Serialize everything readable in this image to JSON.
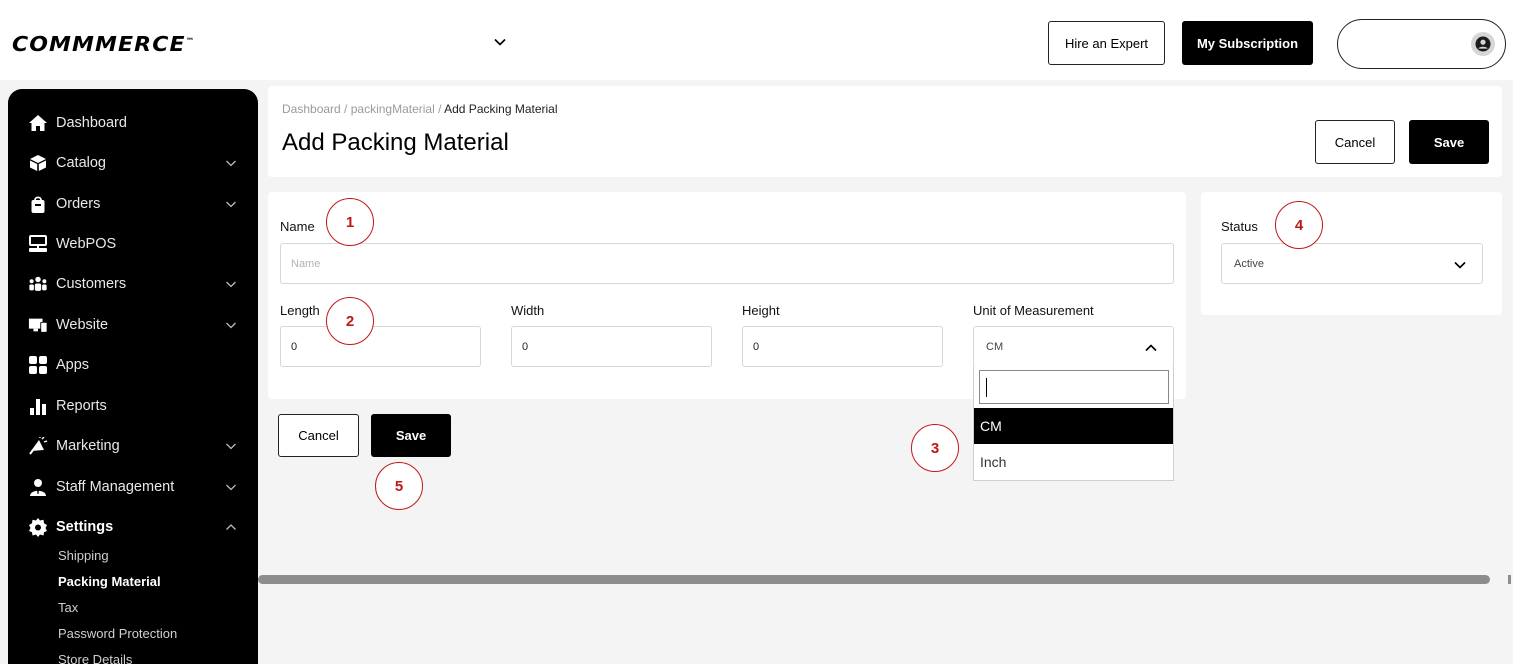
{
  "topbar": {
    "logo": "COMMMERCE",
    "logo_mark": "™",
    "hire_label": "Hire an Expert",
    "subscription_label": "My Subscription"
  },
  "sidebar": {
    "items": [
      {
        "label": "Dashboard",
        "icon": "home-icon",
        "has_chevron": false
      },
      {
        "label": "Catalog",
        "icon": "box-icon",
        "has_chevron": true
      },
      {
        "label": "Orders",
        "icon": "bag-icon",
        "has_chevron": true
      },
      {
        "label": "WebPOS",
        "icon": "pos-icon",
        "has_chevron": false
      },
      {
        "label": "Customers",
        "icon": "users-icon",
        "has_chevron": true
      },
      {
        "label": "Website",
        "icon": "website-icon",
        "has_chevron": true
      },
      {
        "label": "Apps",
        "icon": "apps-icon",
        "has_chevron": false
      },
      {
        "label": "Reports",
        "icon": "chart-icon",
        "has_chevron": false
      },
      {
        "label": "Marketing",
        "icon": "megaphone-icon",
        "has_chevron": true
      },
      {
        "label": "Staff Management",
        "icon": "staff-icon",
        "has_chevron": true
      },
      {
        "label": "Settings",
        "icon": "gear-icon",
        "has_chevron": true,
        "expanded": true
      }
    ],
    "settings_sub": [
      "Shipping",
      "Packing Material",
      "Tax",
      "Password Protection",
      "Store Details"
    ],
    "active_sub": "Packing Material"
  },
  "header": {
    "breadcrumb_dashboard": "Dashboard",
    "breadcrumb_sep": " / ",
    "breadcrumb_section": "packingMaterial",
    "breadcrumb_current": "Add Packing Material",
    "title": "Add Packing Material",
    "cancel_label": "Cancel",
    "save_label": "Save"
  },
  "form": {
    "name_label": "Name",
    "name_placeholder": "Name",
    "length_label": "Length",
    "length_value": "0",
    "width_label": "Width",
    "width_value": "0",
    "height_label": "Height",
    "height_value": "0",
    "uom_label": "Unit of Measurement",
    "uom_value": "CM",
    "uom_options": [
      "CM",
      "Inch"
    ],
    "uom_selected": "CM"
  },
  "status": {
    "label": "Status",
    "value": "Active"
  },
  "bottom": {
    "cancel_label": "Cancel",
    "save_label": "Save"
  },
  "markers": [
    "1",
    "2",
    "3",
    "4",
    "5"
  ],
  "colors": {
    "accent": "#000000",
    "marker": "#c01818",
    "background": "#f4f4f4"
  }
}
